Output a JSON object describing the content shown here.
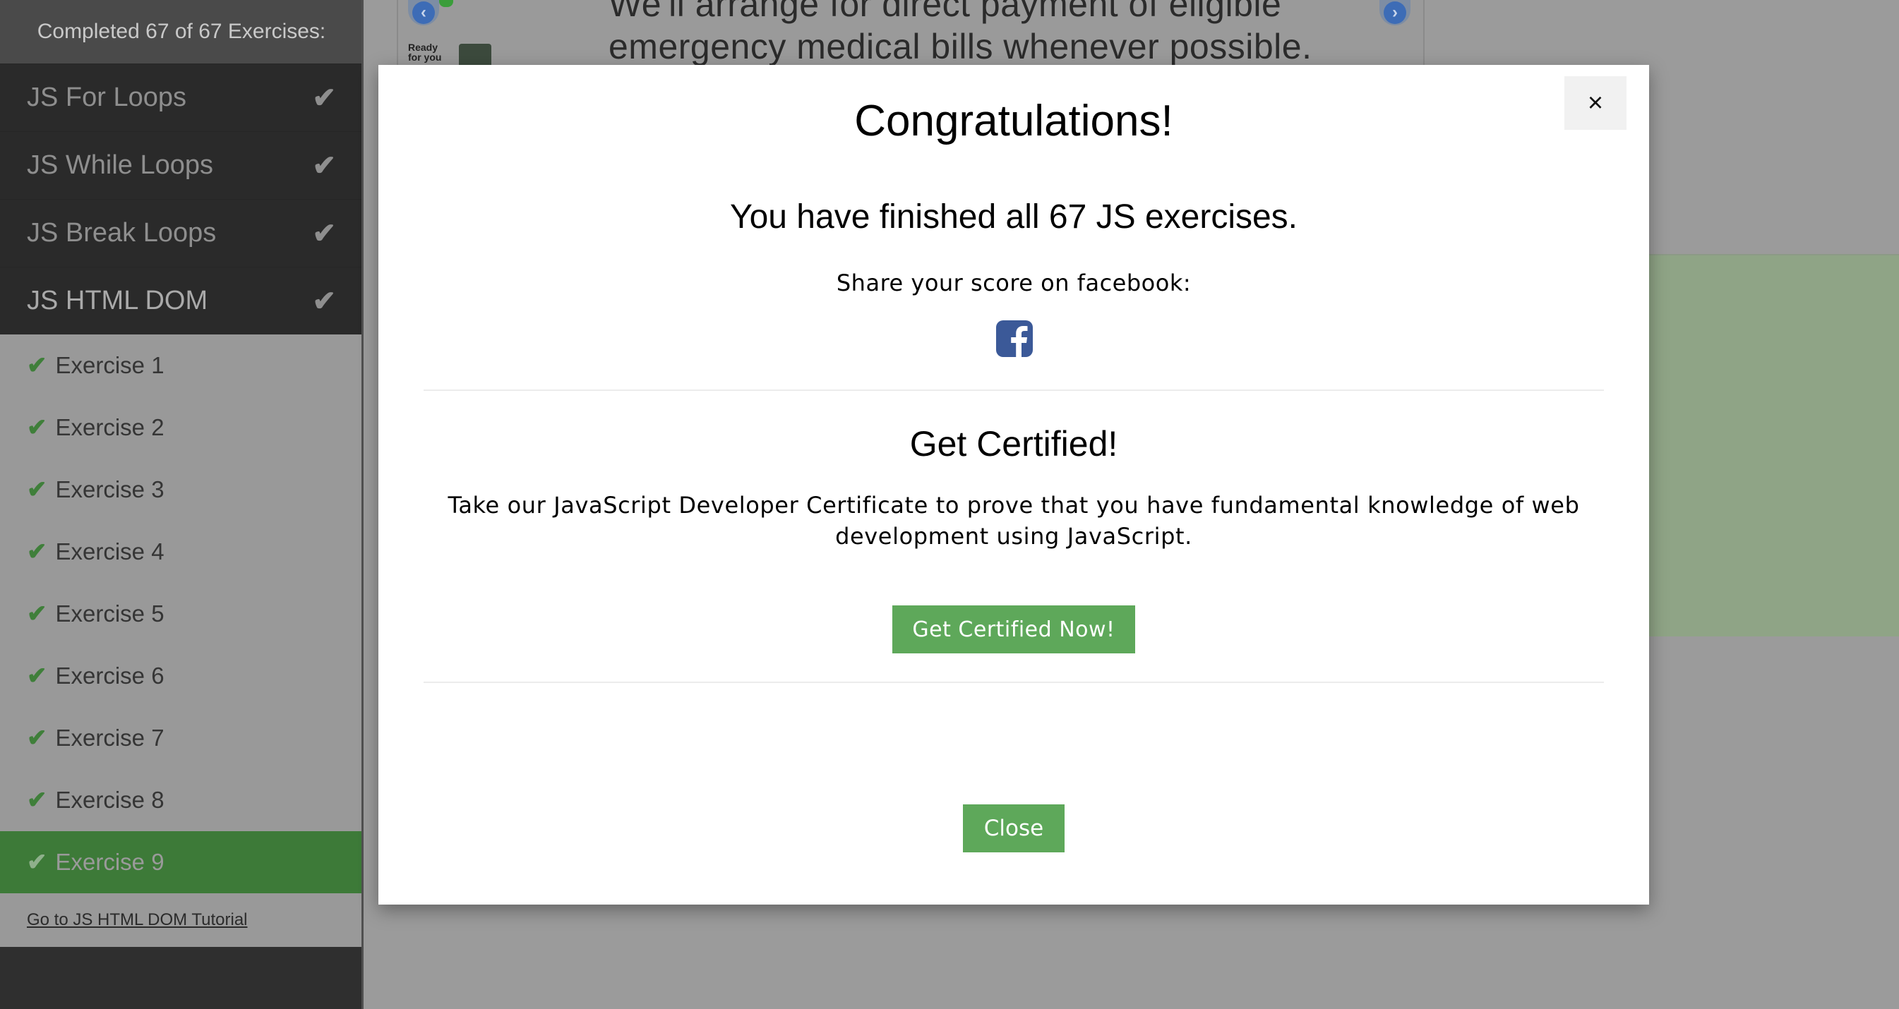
{
  "sidebar": {
    "header": "Completed 67 of 67 Exercises:",
    "sections": [
      {
        "label": "JS For Loops",
        "icon": "check-icon"
      },
      {
        "label": "JS While Loops",
        "icon": "check-icon"
      },
      {
        "label": "JS Break Loops",
        "icon": "check-icon"
      },
      {
        "label": "JS HTML DOM",
        "icon": "check-icon"
      }
    ],
    "exercises": [
      {
        "label": "Exercise 1"
      },
      {
        "label": "Exercise 2"
      },
      {
        "label": "Exercise 3"
      },
      {
        "label": "Exercise 4"
      },
      {
        "label": "Exercise 5"
      },
      {
        "label": "Exercise 6"
      },
      {
        "label": "Exercise 7"
      },
      {
        "label": "Exercise 8"
      },
      {
        "label": "Exercise 9"
      }
    ],
    "current_exercise": "Exercise 9",
    "tutorial_link": "Go to JS HTML DOM Tutorial"
  },
  "ad": {
    "line1": "We'll arrange for direct payment of eligible",
    "line2": "emergency medical bills whenever possible.",
    "thumb_text": "Ready for you"
  },
  "modal": {
    "close_x": "×",
    "title": "Congratulations!",
    "subtitle": "You have finished all 67 JS exercises.",
    "share_text": "Share your score on facebook:",
    "share_icon": "facebook-icon",
    "cert_title": "Get Certified!",
    "cert_text": "Take our JavaScript Developer Certificate to prove that you have fundamental knowledge of web development using JavaScript.",
    "cert_button": "Get Certified Now!",
    "close_button": "Close"
  },
  "colors": {
    "accent_green": "#5ea85a",
    "facebook_blue": "#3b5998",
    "sidebar_dark": "#2f2f2f"
  }
}
